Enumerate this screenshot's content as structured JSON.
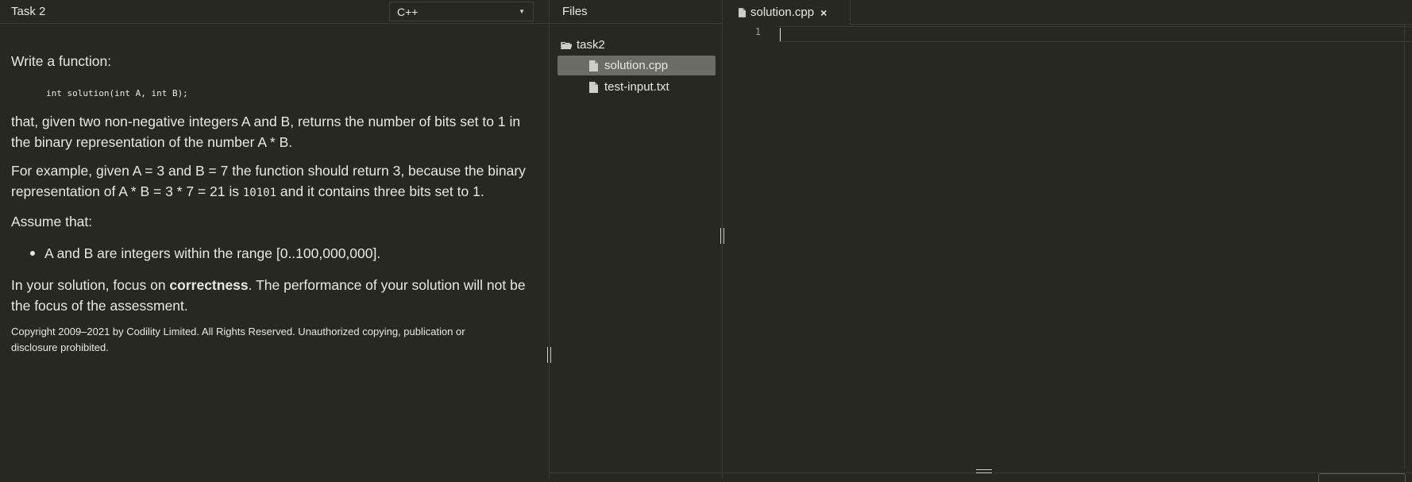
{
  "task": {
    "title": "Task 2",
    "language": "C++",
    "intro": "Write a function:",
    "signature": "int solution(int A, int B);",
    "desc_line1": "that, given two non-negative integers A and B, returns the number of bits set to 1 in",
    "desc_line2": "the binary representation of the number A * B.",
    "example_line1": "For example, given A = 3 and B = 7 the function should return 3, because the binary",
    "example_line2_pre": "representation of A * B = 3 * 7 = 21 is ",
    "example_code": "10101",
    "example_line2_post": " and it contains three bits set to 1.",
    "assume": "Assume that:",
    "bullets": [
      "A and B are integers within the range [0..100,000,000]."
    ],
    "focus_pre": "In your solution, focus on ",
    "focus_bold": "correctness",
    "focus_post": ". The performance of your solution will not be",
    "focus_line2": "the focus of the assessment.",
    "copyright_line1": "Copyright 2009–2021 by Codility Limited. All Rights Reserved. Unauthorized copying, publication or",
    "copyright_line2": "disclosure prohibited."
  },
  "files": {
    "title": "Files",
    "folder": "task2",
    "items": [
      {
        "name": "solution.cpp",
        "selected": true
      },
      {
        "name": "test-input.txt",
        "selected": false
      }
    ]
  },
  "editor": {
    "tab_label": "solution.cpp",
    "close_glyph": "×",
    "line_numbers": [
      "1"
    ]
  },
  "icons": {
    "folder": "folder-open-icon",
    "file": "file-icon",
    "caret": "chevron-down-icon"
  },
  "colors": {
    "background": "#272822",
    "selected_file": "#6c6c67",
    "text": "#e8e8e2"
  }
}
